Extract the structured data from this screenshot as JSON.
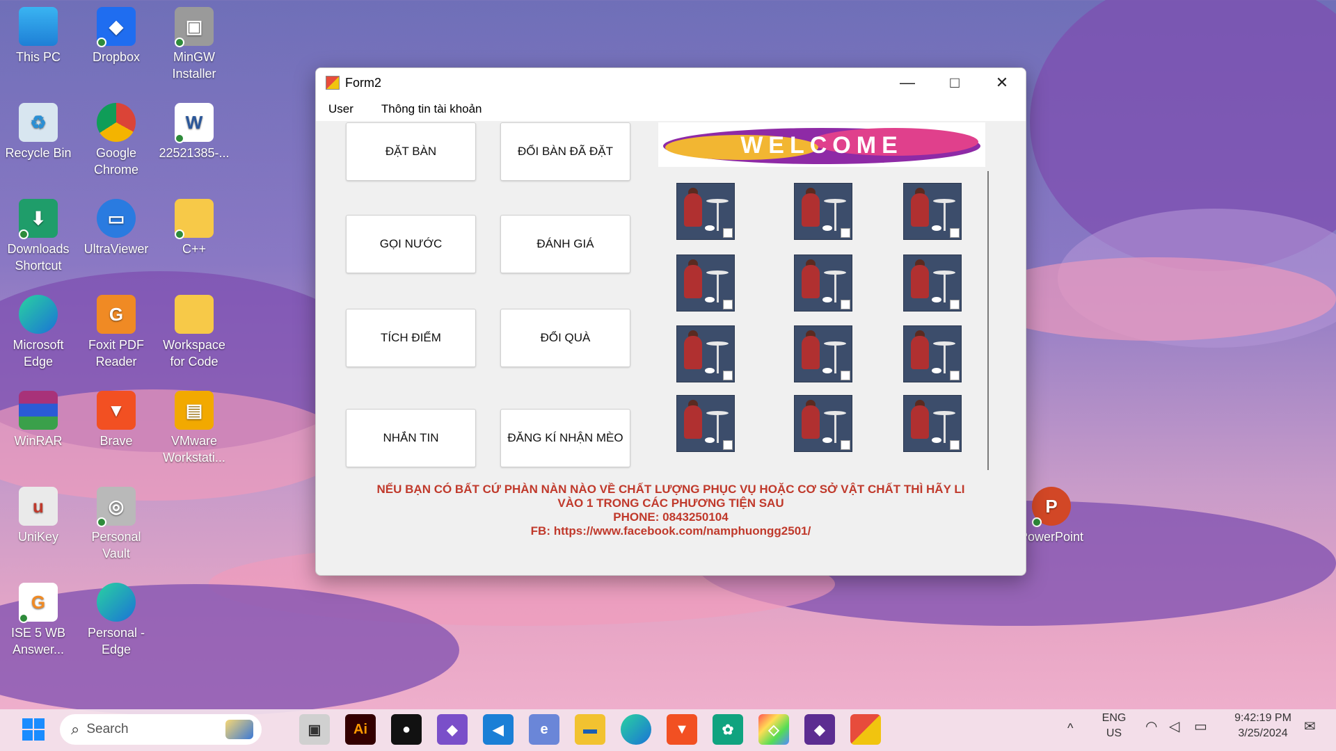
{
  "desktop": {
    "icons": [
      {
        "label": "This PC"
      },
      {
        "label": "Dropbox"
      },
      {
        "label": "MinGW Installer"
      },
      {
        "label": "Recycle Bin"
      },
      {
        "label": "Google Chrome"
      },
      {
        "label": "22521385-..."
      },
      {
        "label": "Downloads Shortcut"
      },
      {
        "label": "UltraViewer"
      },
      {
        "label": "C++"
      },
      {
        "label": "Microsoft Edge"
      },
      {
        "label": "Foxit PDF Reader"
      },
      {
        "label": "Workspace for Code"
      },
      {
        "label": "WinRAR"
      },
      {
        "label": "Brave"
      },
      {
        "label": "VMware Workstati..."
      },
      {
        "label": "UniKey"
      },
      {
        "label": "Personal Vault"
      },
      {
        "label": "PowerPoint"
      },
      {
        "label": "ISE 5 WB Answer..."
      },
      {
        "label": "Personal - Edge"
      }
    ]
  },
  "window": {
    "title": "Form2",
    "menu": [
      "User",
      "Thông tin tài khoản"
    ],
    "buttons": [
      "ĐẶT BÀN",
      "ĐỔI BÀN ĐÃ ĐẶT",
      "GỌI NƯỚC",
      "ĐÁNH GIÁ",
      "TÍCH ĐIỂM",
      "ĐỔI QUÀ",
      "NHẮN TIN",
      "ĐĂNG KÍ NHẬN MÈO"
    ],
    "welcome_text": "WELCOME",
    "notice_lines": [
      "NẾU BẠN CÓ BẤT CỨ PHÀN NÀN NÀO VỀ CHẤT LƯỢNG PHỤC VỤ HOẶC CƠ SỞ VẬT CHẤT THÌ HÃY LI",
      "VÀO 1 TRONG CÁC PHƯƠNG TIỆN SAU",
      "PHONE: 0843250104",
      "FB: https://www.facebook.com/namphuongg2501/"
    ]
  },
  "taskbar": {
    "search_placeholder": "Search",
    "lang_line1": "ENG",
    "lang_line2": "US",
    "time": "9:42:19 PM",
    "date": "3/25/2024"
  }
}
